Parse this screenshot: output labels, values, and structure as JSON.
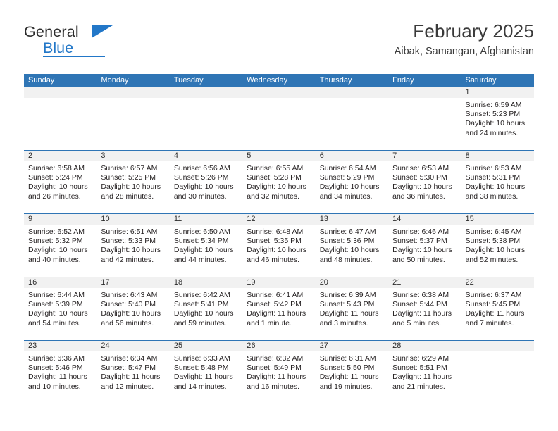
{
  "brand": {
    "name_part1": "General",
    "name_part2": "Blue",
    "triangle_icon": "triangle-icon",
    "accent_color": "#2277c8"
  },
  "header": {
    "title": "February 2025",
    "subtitle": "Aibak, Samangan, Afghanistan"
  },
  "theme": {
    "header_blue": "#2f75b5",
    "date_strip_gray": "#f1f1f1",
    "text_color": "#231f20"
  },
  "calendar": {
    "day_headers": [
      "Sunday",
      "Monday",
      "Tuesday",
      "Wednesday",
      "Thursday",
      "Friday",
      "Saturday"
    ],
    "labels": {
      "sunrise": "Sunrise:",
      "sunset": "Sunset:",
      "daylight": "Daylight:"
    },
    "weeks": [
      {
        "days": [
          {
            "date": "",
            "sunrise": "",
            "sunset": "",
            "daylight": ""
          },
          {
            "date": "",
            "sunrise": "",
            "sunset": "",
            "daylight": ""
          },
          {
            "date": "",
            "sunrise": "",
            "sunset": "",
            "daylight": ""
          },
          {
            "date": "",
            "sunrise": "",
            "sunset": "",
            "daylight": ""
          },
          {
            "date": "",
            "sunrise": "",
            "sunset": "",
            "daylight": ""
          },
          {
            "date": "",
            "sunrise": "",
            "sunset": "",
            "daylight": ""
          },
          {
            "date": "1",
            "sunrise": "Sunrise: 6:59 AM",
            "sunset": "Sunset: 5:23 PM",
            "daylight": "Daylight: 10 hours and 24 minutes."
          }
        ]
      },
      {
        "days": [
          {
            "date": "2",
            "sunrise": "Sunrise: 6:58 AM",
            "sunset": "Sunset: 5:24 PM",
            "daylight": "Daylight: 10 hours and 26 minutes."
          },
          {
            "date": "3",
            "sunrise": "Sunrise: 6:57 AM",
            "sunset": "Sunset: 5:25 PM",
            "daylight": "Daylight: 10 hours and 28 minutes."
          },
          {
            "date": "4",
            "sunrise": "Sunrise: 6:56 AM",
            "sunset": "Sunset: 5:26 PM",
            "daylight": "Daylight: 10 hours and 30 minutes."
          },
          {
            "date": "5",
            "sunrise": "Sunrise: 6:55 AM",
            "sunset": "Sunset: 5:28 PM",
            "daylight": "Daylight: 10 hours and 32 minutes."
          },
          {
            "date": "6",
            "sunrise": "Sunrise: 6:54 AM",
            "sunset": "Sunset: 5:29 PM",
            "daylight": "Daylight: 10 hours and 34 minutes."
          },
          {
            "date": "7",
            "sunrise": "Sunrise: 6:53 AM",
            "sunset": "Sunset: 5:30 PM",
            "daylight": "Daylight: 10 hours and 36 minutes."
          },
          {
            "date": "8",
            "sunrise": "Sunrise: 6:53 AM",
            "sunset": "Sunset: 5:31 PM",
            "daylight": "Daylight: 10 hours and 38 minutes."
          }
        ]
      },
      {
        "days": [
          {
            "date": "9",
            "sunrise": "Sunrise: 6:52 AM",
            "sunset": "Sunset: 5:32 PM",
            "daylight": "Daylight: 10 hours and 40 minutes."
          },
          {
            "date": "10",
            "sunrise": "Sunrise: 6:51 AM",
            "sunset": "Sunset: 5:33 PM",
            "daylight": "Daylight: 10 hours and 42 minutes."
          },
          {
            "date": "11",
            "sunrise": "Sunrise: 6:50 AM",
            "sunset": "Sunset: 5:34 PM",
            "daylight": "Daylight: 10 hours and 44 minutes."
          },
          {
            "date": "12",
            "sunrise": "Sunrise: 6:48 AM",
            "sunset": "Sunset: 5:35 PM",
            "daylight": "Daylight: 10 hours and 46 minutes."
          },
          {
            "date": "13",
            "sunrise": "Sunrise: 6:47 AM",
            "sunset": "Sunset: 5:36 PM",
            "daylight": "Daylight: 10 hours and 48 minutes."
          },
          {
            "date": "14",
            "sunrise": "Sunrise: 6:46 AM",
            "sunset": "Sunset: 5:37 PM",
            "daylight": "Daylight: 10 hours and 50 minutes."
          },
          {
            "date": "15",
            "sunrise": "Sunrise: 6:45 AM",
            "sunset": "Sunset: 5:38 PM",
            "daylight": "Daylight: 10 hours and 52 minutes."
          }
        ]
      },
      {
        "days": [
          {
            "date": "16",
            "sunrise": "Sunrise: 6:44 AM",
            "sunset": "Sunset: 5:39 PM",
            "daylight": "Daylight: 10 hours and 54 minutes."
          },
          {
            "date": "17",
            "sunrise": "Sunrise: 6:43 AM",
            "sunset": "Sunset: 5:40 PM",
            "daylight": "Daylight: 10 hours and 56 minutes."
          },
          {
            "date": "18",
            "sunrise": "Sunrise: 6:42 AM",
            "sunset": "Sunset: 5:41 PM",
            "daylight": "Daylight: 10 hours and 59 minutes."
          },
          {
            "date": "19",
            "sunrise": "Sunrise: 6:41 AM",
            "sunset": "Sunset: 5:42 PM",
            "daylight": "Daylight: 11 hours and 1 minute."
          },
          {
            "date": "20",
            "sunrise": "Sunrise: 6:39 AM",
            "sunset": "Sunset: 5:43 PM",
            "daylight": "Daylight: 11 hours and 3 minutes."
          },
          {
            "date": "21",
            "sunrise": "Sunrise: 6:38 AM",
            "sunset": "Sunset: 5:44 PM",
            "daylight": "Daylight: 11 hours and 5 minutes."
          },
          {
            "date": "22",
            "sunrise": "Sunrise: 6:37 AM",
            "sunset": "Sunset: 5:45 PM",
            "daylight": "Daylight: 11 hours and 7 minutes."
          }
        ]
      },
      {
        "days": [
          {
            "date": "23",
            "sunrise": "Sunrise: 6:36 AM",
            "sunset": "Sunset: 5:46 PM",
            "daylight": "Daylight: 11 hours and 10 minutes."
          },
          {
            "date": "24",
            "sunrise": "Sunrise: 6:34 AM",
            "sunset": "Sunset: 5:47 PM",
            "daylight": "Daylight: 11 hours and 12 minutes."
          },
          {
            "date": "25",
            "sunrise": "Sunrise: 6:33 AM",
            "sunset": "Sunset: 5:48 PM",
            "daylight": "Daylight: 11 hours and 14 minutes."
          },
          {
            "date": "26",
            "sunrise": "Sunrise: 6:32 AM",
            "sunset": "Sunset: 5:49 PM",
            "daylight": "Daylight: 11 hours and 16 minutes."
          },
          {
            "date": "27",
            "sunrise": "Sunrise: 6:31 AM",
            "sunset": "Sunset: 5:50 PM",
            "daylight": "Daylight: 11 hours and 19 minutes."
          },
          {
            "date": "28",
            "sunrise": "Sunrise: 6:29 AM",
            "sunset": "Sunset: 5:51 PM",
            "daylight": "Daylight: 11 hours and 21 minutes."
          },
          {
            "date": "",
            "sunrise": "",
            "sunset": "",
            "daylight": ""
          }
        ]
      }
    ]
  }
}
